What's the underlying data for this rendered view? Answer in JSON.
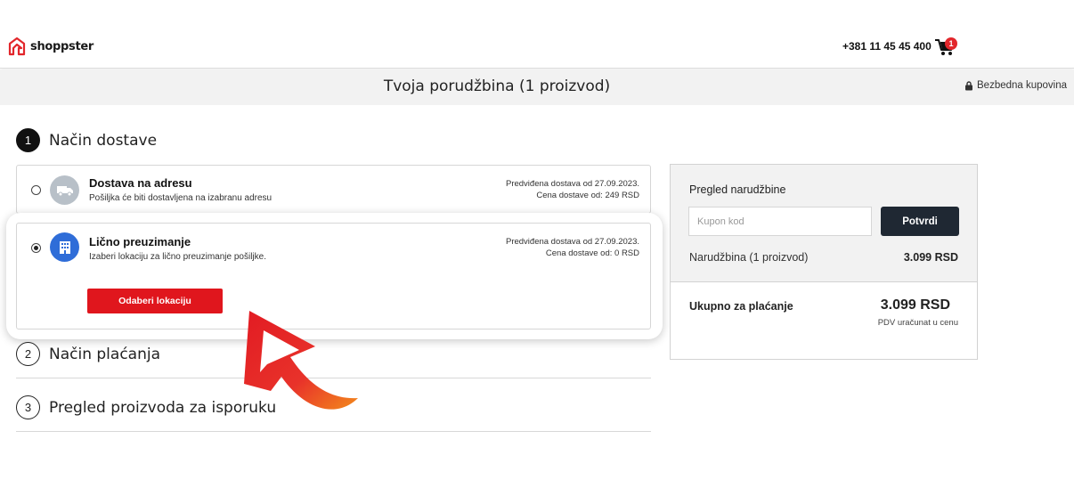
{
  "header": {
    "logo_text": "shoppster",
    "phone": "+381 11 45 45 400",
    "cart_count": "1",
    "order_title": "Tvoja porudžbina (1 proizvod)",
    "secure_label": "Bezbedna kupovina"
  },
  "steps": [
    {
      "number": "1",
      "label": "Način dostave"
    },
    {
      "number": "2",
      "label": "Način plaćanja"
    },
    {
      "number": "3",
      "label": "Pregled proizvoda za isporuku"
    }
  ],
  "delivery_options": [
    {
      "title": "Dostava na adresu",
      "subtitle": "Pošiljka će biti dostavljena na izabranu adresu",
      "eta": "Predviđena dostava od 27.09.2023.",
      "price": "Cena dostave od: 249 RSD",
      "selected": false,
      "icon": "truck-icon"
    },
    {
      "title": "Lično preuzimanje",
      "subtitle": "Izaberi lokaciju za lično preuzimanje pošiljke.",
      "eta": "Predviđena dostava od 27.09.2023.",
      "price": "Cena dostave od: 0 RSD",
      "selected": true,
      "icon": "building-icon",
      "button_label": "Odaberi lokaciju"
    }
  ],
  "summary": {
    "title": "Pregled narudžbine",
    "coupon_placeholder": "Kupon kod",
    "confirm_label": "Potvrdi",
    "order_label": "Narudžbina (1 proizvod)",
    "order_value": "3.099 RSD",
    "total_label": "Ukupno za plaćanje",
    "total_value": "3.099 RSD",
    "vat_note": "PDV uračunat u cenu"
  },
  "colors": {
    "accent_red": "#e0161d",
    "dark_button": "#1f2833",
    "icon_blue": "#2f6dd8",
    "icon_grey": "#b8c0c8"
  }
}
